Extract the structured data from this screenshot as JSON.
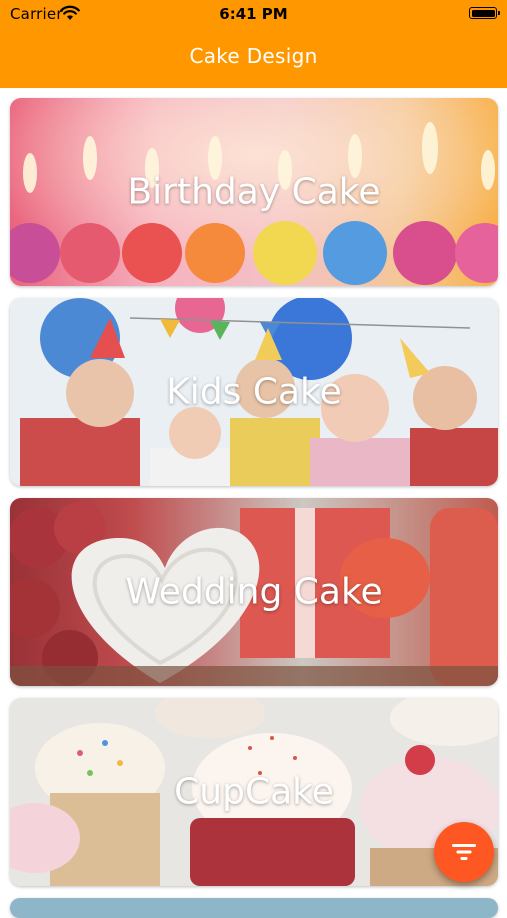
{
  "status_bar": {
    "carrier": "Carrier",
    "time": "6:41 PM",
    "wifi_icon": "wifi-icon",
    "battery_icon": "battery-full-icon"
  },
  "header": {
    "title": "Cake Design",
    "background_color": "#FF9800"
  },
  "categories": [
    {
      "label": "Birthday Cake",
      "image": "birthday-candles-photo"
    },
    {
      "label": "Kids Cake",
      "image": "children-party-photo"
    },
    {
      "label": "Wedding Cake",
      "image": "heart-cake-roses-photo"
    },
    {
      "label": "CupCake",
      "image": "cupcakes-photo"
    }
  ],
  "fab": {
    "icon": "filter-icon",
    "color": "#FF5722"
  }
}
